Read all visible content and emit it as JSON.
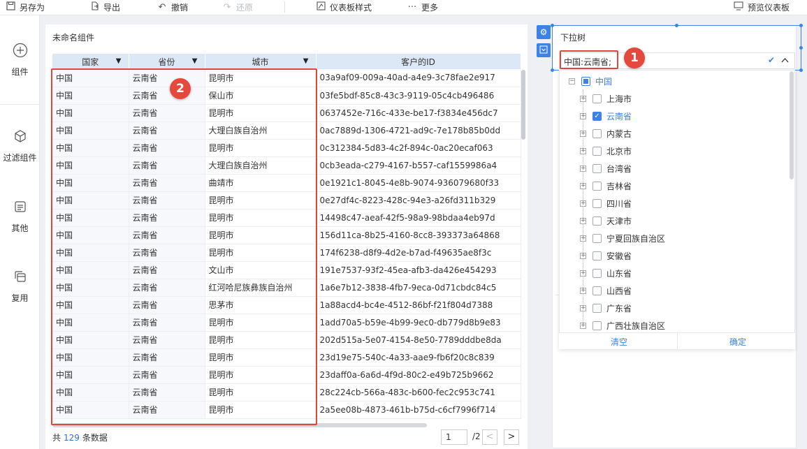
{
  "toolbar": {
    "save_as": "另存为",
    "export": "导出",
    "undo": "撤销",
    "redo": "还原",
    "dashboard_style": "仪表板样式",
    "more": "更多",
    "preview": "预览仪表板"
  },
  "leftnav": {
    "items": [
      {
        "label": "组件",
        "icon": "plus-circle-icon"
      },
      {
        "label": "过滤组件",
        "icon": "cube-icon"
      },
      {
        "label": "其他",
        "icon": "document-icon"
      },
      {
        "label": "复用",
        "icon": "copy-icon"
      }
    ]
  },
  "table_widget": {
    "title": "未命名组件",
    "columns": [
      "国家",
      "省份",
      "城市",
      "客户的ID"
    ],
    "rows": [
      [
        "中国",
        "云南省",
        "昆明市",
        "03a9af09-009a-40ad-a4e9-3c78fae2e917"
      ],
      [
        "中国",
        "云南省",
        "保山市",
        "03fe5bdf-85c8-43c3-9119-05c4cb496486"
      ],
      [
        "中国",
        "云南省",
        "昆明市",
        "0637452e-716c-433e-be17-f3834e456dc7"
      ],
      [
        "中国",
        "云南省",
        "大理白族自治州",
        "0ac7889d-1306-4721-ad9c-7e178b85b0dd"
      ],
      [
        "中国",
        "云南省",
        "昆明市",
        "0c312384-5d83-4c2f-894c-0ac20ecaf063"
      ],
      [
        "中国",
        "云南省",
        "大理白族自治州",
        "0cb3eada-c279-4167-b557-caf1559986a4"
      ],
      [
        "中国",
        "云南省",
        "曲靖市",
        "0e1921c1-8045-4e8b-9074-936079680f33"
      ],
      [
        "中国",
        "云南省",
        "昆明市",
        "0e27df4c-8223-428c-94e3-a26fd311b329"
      ],
      [
        "中国",
        "云南省",
        "昆明市",
        "14498c47-aeaf-42f5-98a9-98bdaa4eb97d"
      ],
      [
        "中国",
        "云南省",
        "昆明市",
        "156d11ca-8b25-4160-8cc8-393373a64868"
      ],
      [
        "中国",
        "云南省",
        "昆明市",
        "174f6238-d8f9-4d2e-b7ad-f49635ae8f3c"
      ],
      [
        "中国",
        "云南省",
        "文山市",
        "191e7537-93f2-45ea-afb3-da426e454293"
      ],
      [
        "中国",
        "云南省",
        "红河哈尼族彝族自治州",
        "1a6e7b12-3838-4fb7-9eca-0d71cbdc84c5"
      ],
      [
        "中国",
        "云南省",
        "思茅市",
        "1a88acd4-bc4e-4512-86bf-f21f804d7388"
      ],
      [
        "中国",
        "云南省",
        "昆明市",
        "1add70a5-b59e-4b99-9ec0-db779d8b9e83"
      ],
      [
        "中国",
        "云南省",
        "昆明市",
        "202d515a-5e07-4154-8e50-7789dddbe8da"
      ],
      [
        "中国",
        "云南省",
        "昆明市",
        "23d19e75-540c-4a33-aae9-fb6f20c8c839"
      ],
      [
        "中国",
        "云南省",
        "昆明市",
        "23daff0a-6a6d-4f9d-80c2-e49b725b9662"
      ],
      [
        "中国",
        "云南省",
        "昆明市",
        "28c224cb-566a-483c-b600-fec2c953c741"
      ],
      [
        "中国",
        "云南省",
        "昆明市",
        "2a5ee08b-4873-461b-b75d-c6cf7996f714"
      ]
    ],
    "footer_prefix": "共",
    "total_count": "129",
    "footer_suffix": "条数据",
    "page_current": "1",
    "page_total": "/2",
    "prev": "<",
    "next": ">"
  },
  "filter_widget": {
    "title": "下拉树",
    "value": "中国:云南省;",
    "tree": {
      "root": "中国",
      "provinces": [
        {
          "label": "上海市",
          "checked": false
        },
        {
          "label": "云南省",
          "checked": true
        },
        {
          "label": "内蒙古",
          "checked": false
        },
        {
          "label": "北京市",
          "checked": false
        },
        {
          "label": "台湾省",
          "checked": false
        },
        {
          "label": "吉林省",
          "checked": false
        },
        {
          "label": "四川省",
          "checked": false
        },
        {
          "label": "天津市",
          "checked": false
        },
        {
          "label": "宁夏回族自治区",
          "checked": false
        },
        {
          "label": "安徽省",
          "checked": false
        },
        {
          "label": "山东省",
          "checked": false
        },
        {
          "label": "山西省",
          "checked": false
        },
        {
          "label": "广东省",
          "checked": false
        },
        {
          "label": "广西壮族自治区",
          "checked": false
        }
      ]
    },
    "clear_label": "清空",
    "confirm_label": "确定"
  },
  "annotations": {
    "badge_1": "1",
    "badge_2": "2"
  },
  "colors": {
    "accent": "#3e82e6",
    "highlight_red": "#e0463b",
    "header_bg": "#dde8f6"
  }
}
